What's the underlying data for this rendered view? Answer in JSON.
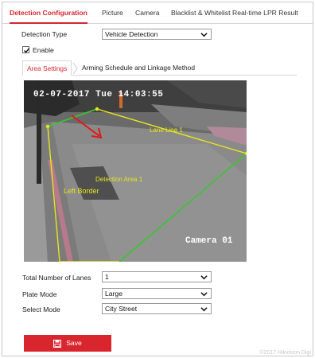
{
  "nav": {
    "tabs": [
      {
        "label": "Detection Configuration",
        "active": true
      },
      {
        "label": "Picture"
      },
      {
        "label": "Camera"
      },
      {
        "label": "Blacklist & Whitelist"
      },
      {
        "label": "Real-time LPR Result"
      }
    ],
    "accent_color": "#d9262e"
  },
  "detection_type": {
    "label": "Detection Type",
    "value": "Vehicle Detection"
  },
  "enable": {
    "label": "Enable",
    "checked": true
  },
  "subtabs": [
    {
      "label": "Area Settings",
      "active": true
    },
    {
      "label": "Arming Schedule and Linkage Method"
    }
  ],
  "video": {
    "osd_time": "02-07-2017 Tue 14:03:55",
    "camera_label": "Camera 01",
    "lane_line_label": "Lane Line 1",
    "detection_area_label": "Detection Area 1",
    "left_border_label": "Left Border"
  },
  "settings": [
    {
      "label": "Total Number of Lanes",
      "value": "1"
    },
    {
      "label": "Plate Mode",
      "value": "Large"
    },
    {
      "label": "Select Mode",
      "value": "City Street"
    }
  ],
  "save": {
    "label": "Save",
    "icon": "floppy-disk-icon"
  },
  "footer": {
    "text": "©2017 Hikvision Digi"
  }
}
